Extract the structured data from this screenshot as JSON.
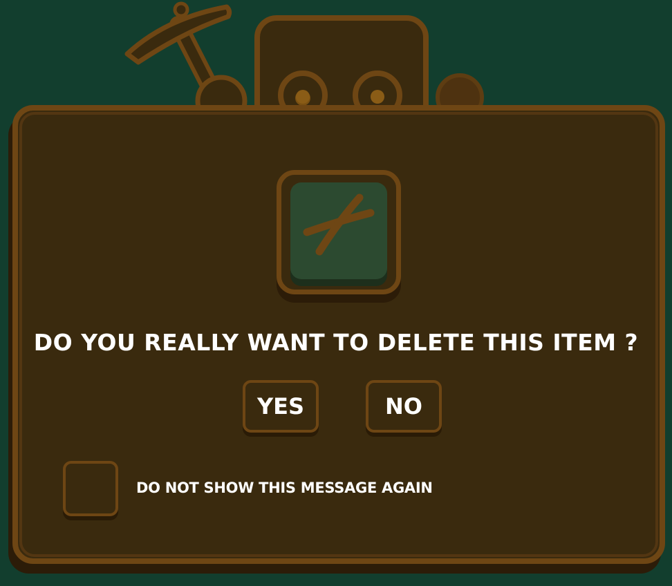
{
  "dialog": {
    "question": "DO YOU REALLY WANT TO DELETE THIS ITEM ?",
    "yes_label": "YES",
    "no_label": "NO",
    "checkbox_label": "DO NOT SHOW THIS MESSAGE AGAIN",
    "checkbox_checked": false,
    "item_icon": "crossed-sticks-icon"
  },
  "decorations": {
    "left": "pickaxe-icon",
    "top": "robot-head-icon",
    "right": "bolt-icon"
  },
  "colors": {
    "background": "#123e2e",
    "panel": "#3a2a0e",
    "panel_border": "#6e4614",
    "item_slot": "#2c4a30",
    "text": "#ffffff"
  }
}
